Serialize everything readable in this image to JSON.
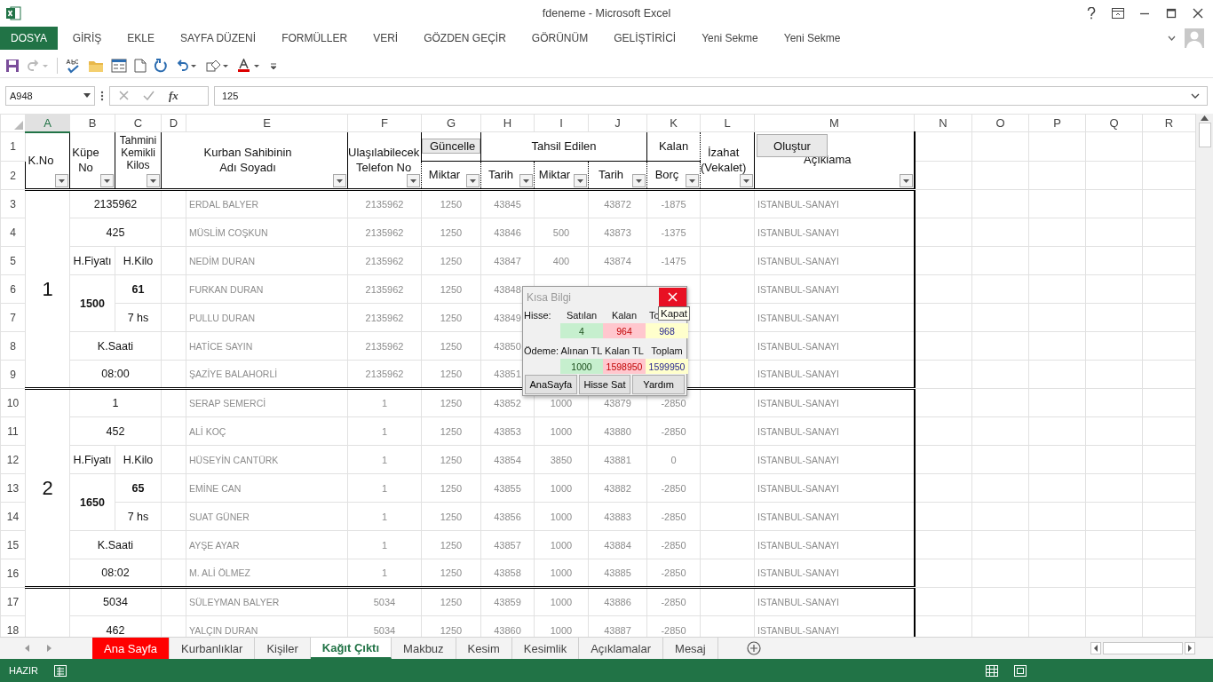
{
  "window": {
    "title": "fdeneme - Microsoft Excel"
  },
  "ribbon_tabs": [
    {
      "label": "DOSYA",
      "kind": "file"
    },
    {
      "label": "GİRİŞ",
      "kind": "tab"
    },
    {
      "label": "EKLE",
      "kind": "tab"
    },
    {
      "label": "SAYFA DÜZENİ",
      "kind": "tab"
    },
    {
      "label": "FORMÜLLER",
      "kind": "tab"
    },
    {
      "label": "VERİ",
      "kind": "tab"
    },
    {
      "label": "GÖZDEN GEÇİR",
      "kind": "tab"
    },
    {
      "label": "GÖRÜNÜM",
      "kind": "tab"
    },
    {
      "label": "GELİŞTİRİCİ",
      "kind": "tab"
    },
    {
      "label": "Yeni Sekme",
      "kind": "tab"
    },
    {
      "label": "Yeni Sekme",
      "kind": "tab"
    }
  ],
  "formula_bar": {
    "name_box": "A948",
    "function_label": "fx",
    "value": "125"
  },
  "columns": [
    {
      "letter": "A",
      "selected": true
    },
    {
      "letter": "B",
      "selected": false
    },
    {
      "letter": "C",
      "selected": false
    },
    {
      "letter": "D",
      "selected": false
    },
    {
      "letter": "E",
      "selected": false
    },
    {
      "letter": "F",
      "selected": false
    },
    {
      "letter": "G",
      "selected": false
    },
    {
      "letter": "H",
      "selected": false
    },
    {
      "letter": "I",
      "selected": false
    },
    {
      "letter": "J",
      "selected": false
    },
    {
      "letter": "K",
      "selected": false
    },
    {
      "letter": "L",
      "selected": false
    },
    {
      "letter": "M",
      "selected": false
    },
    {
      "letter": "N",
      "selected": false
    },
    {
      "letter": "O",
      "selected": false
    },
    {
      "letter": "P",
      "selected": false
    },
    {
      "letter": "Q",
      "selected": false
    },
    {
      "letter": "R",
      "selected": false
    }
  ],
  "row_numbers": [
    "1",
    "2",
    "3",
    "4",
    "5",
    "6",
    "7",
    "8",
    "9",
    "10",
    "11",
    "12",
    "13",
    "14",
    "15",
    "16",
    "17",
    "18"
  ],
  "header": {
    "k_no": "K.No",
    "kupe_no": "Küpe\nNo",
    "weight": "Tahmini\nKemikli\nKilos",
    "owner": "Kurban Sahibinin\nAdı Soyadı",
    "phone": "Ulaşılabilecek\nTelefon No",
    "update_button": "Güncelle",
    "amount": "Miktar",
    "collected": "Tahsil Edilen",
    "date": "Tarih",
    "collected_amount": "Miktar",
    "collected_date": "Tarih",
    "remaining": "Kalan",
    "debt": "Borç",
    "note": "İzahat\n(Vekalet)",
    "create_button": "Oluştur",
    "description": "Açıklama"
  },
  "groups": [
    {
      "k_no": "1",
      "kupe_no": "2135962",
      "count": "425",
      "price_label": "H.Fiyatı",
      "kilo_label": "H.Kilo",
      "price": "1500",
      "kilo": "61",
      "duration": "7 hs",
      "time_label": "K.Saati",
      "time": "08:00",
      "entries": [
        {
          "name": "ERDAL BALYER",
          "phone": "2135962",
          "amount": "1250",
          "date": "43845",
          "paid_date": "43872",
          "debt": "-1875",
          "description": "ISTANBUL-SANAYI"
        },
        {
          "name": "MÜSLİM COŞKUN",
          "phone": "2135962",
          "amount": "1250",
          "date": "43846",
          "paid": "500",
          "paid_date": "43873",
          "debt": "-1375",
          "description": "ISTANBUL-SANAYI"
        },
        {
          "name": "NEDİM DURAN",
          "phone": "2135962",
          "amount": "1250",
          "date": "43847",
          "paid": "400",
          "paid_date": "43874",
          "debt": "-1475",
          "description": "ISTANBUL-SANAYI"
        },
        {
          "name": "FURKAN DURAN",
          "phone": "2135962",
          "amount": "1250",
          "date": "43848",
          "description": "ISTANBUL-SANAYI"
        },
        {
          "name": "PULLU DURAN",
          "phone": "2135962",
          "amount": "1250",
          "date": "43849",
          "description": "ISTANBUL-SANAYI"
        },
        {
          "name": "HATİCE SAYIN",
          "phone": "2135962",
          "amount": "1250",
          "date": "43850",
          "description": "ISTANBUL-SANAYI"
        },
        {
          "name": "ŞAZİYE BALAHORLİ",
          "phone": "2135962",
          "amount": "1250",
          "date": "43851",
          "description": "ISTANBUL-SANAYI"
        }
      ]
    },
    {
      "k_no": "2",
      "kupe_no": "1",
      "count": "452",
      "price_label": "H.Fiyatı",
      "kilo_label": "H.Kilo",
      "price": "1650",
      "kilo": "65",
      "duration": "7 hs",
      "time_label": "K.Saati",
      "time": "08:02",
      "entries": [
        {
          "name": "SERAP SEMERCİ",
          "phone": "1",
          "amount": "1250",
          "date": "43852",
          "paid": "1000",
          "paid_date": "43879",
          "debt": "-2850",
          "description": "ISTANBUL-SANAYI"
        },
        {
          "name": "ALİ KOÇ",
          "phone": "1",
          "amount": "1250",
          "date": "43853",
          "paid": "1000",
          "paid_date": "43880",
          "debt": "-2850",
          "description": "ISTANBUL-SANAYI"
        },
        {
          "name": "HÜSEYİN CANTÜRK",
          "phone": "1",
          "amount": "1250",
          "date": "43854",
          "paid": "3850",
          "paid_date": "43881",
          "debt": "0",
          "description": "ISTANBUL-SANAYI"
        },
        {
          "name": "EMİNE CAN",
          "phone": "1",
          "amount": "1250",
          "date": "43855",
          "paid": "1000",
          "paid_date": "43882",
          "debt": "-2850",
          "description": "ISTANBUL-SANAYI"
        },
        {
          "name": "SUAT GÜNER",
          "phone": "1",
          "amount": "1250",
          "date": "43856",
          "paid": "1000",
          "paid_date": "43883",
          "debt": "-2850",
          "description": "ISTANBUL-SANAYI"
        },
        {
          "name": "AYŞE AYAR",
          "phone": "1",
          "amount": "1250",
          "date": "43857",
          "paid": "1000",
          "paid_date": "43884",
          "debt": "-2850",
          "description": "ISTANBUL-SANAYI"
        },
        {
          "name": "M. ALİ ÖLMEZ",
          "phone": "1",
          "amount": "1250",
          "date": "43858",
          "paid": "1000",
          "paid_date": "43885",
          "debt": "-2850",
          "description": "ISTANBUL-SANAYI"
        }
      ]
    },
    {
      "kupe_no": "5034",
      "count": "462",
      "entries": [
        {
          "name": "SÜLEYMAN BALYER",
          "phone": "5034",
          "amount": "1250",
          "date": "43859",
          "paid": "1000",
          "paid_date": "43886",
          "debt": "-2850",
          "description": "ISTANBUL-SANAYI"
        },
        {
          "name": "YALÇIN DURAN",
          "phone": "5034",
          "amount": "1250",
          "date": "43860",
          "paid": "1000",
          "paid_date": "43887",
          "debt": "-2850",
          "description": "ISTANBUL-SANAYI"
        }
      ]
    }
  ],
  "popup": {
    "title": "Kısa Bilgi",
    "close_tooltip": "Kapat",
    "sections": [
      {
        "label": "Hisse:",
        "headers": [
          "Satılan",
          "Kalan",
          "To"
        ],
        "values": [
          {
            "text": "4",
            "color": "#c6efce"
          },
          {
            "text": "964",
            "color": "#ffc7ce"
          },
          {
            "text": "968",
            "color": "#ffffcc"
          }
        ]
      },
      {
        "label": "Ödeme:",
        "headers": [
          "Alınan TL",
          "Kalan TL",
          "Toplam"
        ],
        "values": [
          {
            "text": "1000",
            "color": "#c6efce"
          },
          {
            "text": "1598950",
            "color": "#ffc7ce"
          },
          {
            "text": "1599950",
            "color": "#ffffcc"
          }
        ]
      }
    ],
    "buttons": [
      "AnaSayfa",
      "Hisse Sat",
      "Yardım"
    ]
  },
  "sheet_tabs": [
    {
      "label": "Ana Sayfa",
      "selected": false,
      "color": "#ff0000"
    },
    {
      "label": "Kurbanlıklar",
      "selected": false
    },
    {
      "label": "Kişiler",
      "selected": false
    },
    {
      "label": "Kağıt Çıktı",
      "selected": true
    },
    {
      "label": "Makbuz",
      "selected": false
    },
    {
      "label": "Kesim",
      "selected": false
    },
    {
      "label": "Kesimlik",
      "selected": false
    },
    {
      "label": "Açıklamalar",
      "selected": false
    },
    {
      "label": "Mesaj",
      "selected": false
    }
  ],
  "status_bar": {
    "mode": "HAZIR"
  }
}
